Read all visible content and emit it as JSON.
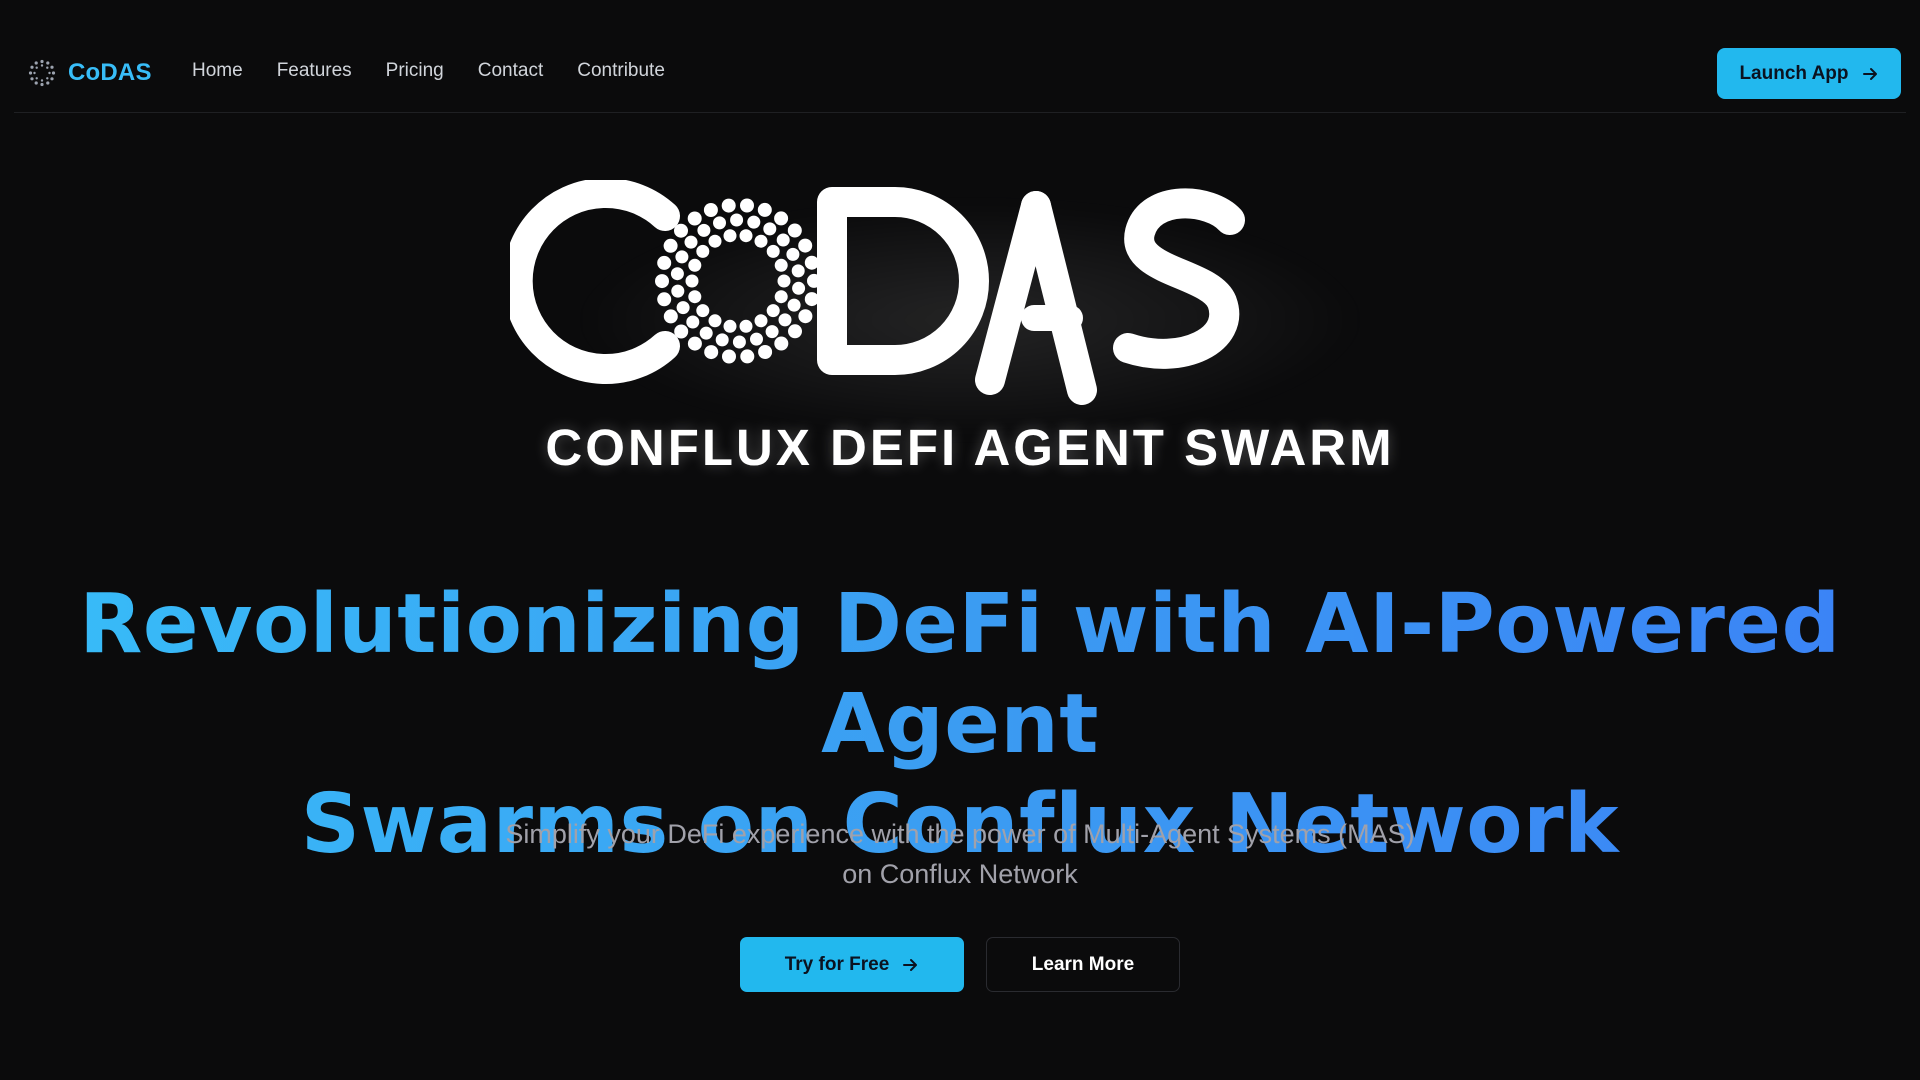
{
  "brand": {
    "name": "CoDAS",
    "icon": "codas-dots-logo-icon",
    "color": "#38bdf8"
  },
  "nav": {
    "items": [
      {
        "label": "Home"
      },
      {
        "label": "Features"
      },
      {
        "label": "Pricing"
      },
      {
        "label": "Contact"
      },
      {
        "label": "Contribute"
      }
    ],
    "launch_label": "Launch App",
    "launch_icon": "arrow-right-icon"
  },
  "hero": {
    "logo_wordmark": "CODAS",
    "logo_tagline": "CONFLUX DEFI AGENT SWARM",
    "headline_line1": "Revolutionizing DeFi with AI-Powered Agent",
    "headline_line2": "Swarms on Conflux Network",
    "subtitle_line1": "Simplify your DeFi experience with the power of Multi-Agent Systems (MAS)",
    "subtitle_line2": "on Conflux Network",
    "primary_cta": "Try for Free",
    "primary_cta_icon": "arrow-right-icon",
    "secondary_cta": "Learn More"
  },
  "colors": {
    "background": "#0b0b0c",
    "accent": "#22b8ee",
    "headline_gradient_start": "#38bdf8",
    "headline_gradient_end": "#3b82f6"
  }
}
